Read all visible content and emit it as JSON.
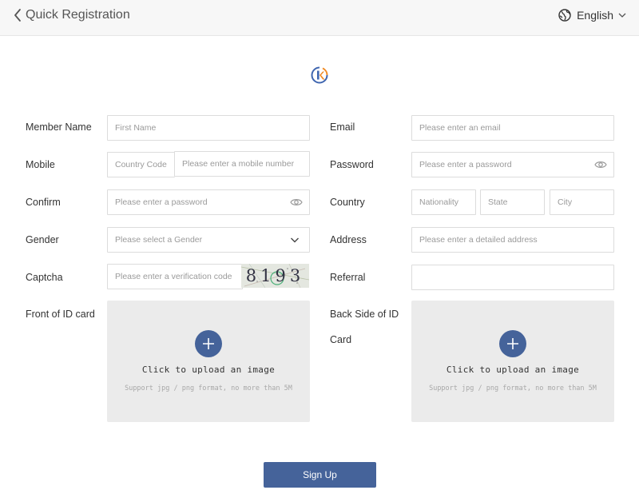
{
  "header": {
    "title": "Quick Registration",
    "language": "English"
  },
  "form": {
    "member_name": {
      "label": "Member Name",
      "placeholder": "First Name"
    },
    "email": {
      "label": "Email",
      "placeholder": "Please enter an email"
    },
    "mobile": {
      "label": "Mobile",
      "country_code_placeholder": "Country Code",
      "placeholder": "Please enter a mobile number"
    },
    "password": {
      "label": "Password",
      "placeholder": "Please enter a password"
    },
    "confirm": {
      "label": "Confirm",
      "placeholder": "Please enter a password"
    },
    "country": {
      "label": "Country",
      "nationality_placeholder": "Nationality",
      "state_placeholder": "State",
      "city_placeholder": "City"
    },
    "gender": {
      "label": "Gender",
      "placeholder": "Please select a Gender"
    },
    "address": {
      "label": "Address",
      "placeholder": "Please enter a detailed address"
    },
    "captcha": {
      "label": "Captcha",
      "placeholder": "Please enter a verification code",
      "code": "8193"
    },
    "referral": {
      "label": "Referral",
      "value": ""
    },
    "front_id": {
      "label": "Front of ID card",
      "upload_text": "Click to upload an image",
      "hint": "Support jpg / png format, no more than 5M"
    },
    "back_id": {
      "label_line1": "Back Side of ID",
      "label_line2": "Card",
      "upload_text": "Click to upload an image",
      "hint": "Support jpg / png format, no more than 5M"
    }
  },
  "signup_label": "Sign Up",
  "colors": {
    "accent": "#45639a",
    "logo_orange": "#f08a24"
  }
}
